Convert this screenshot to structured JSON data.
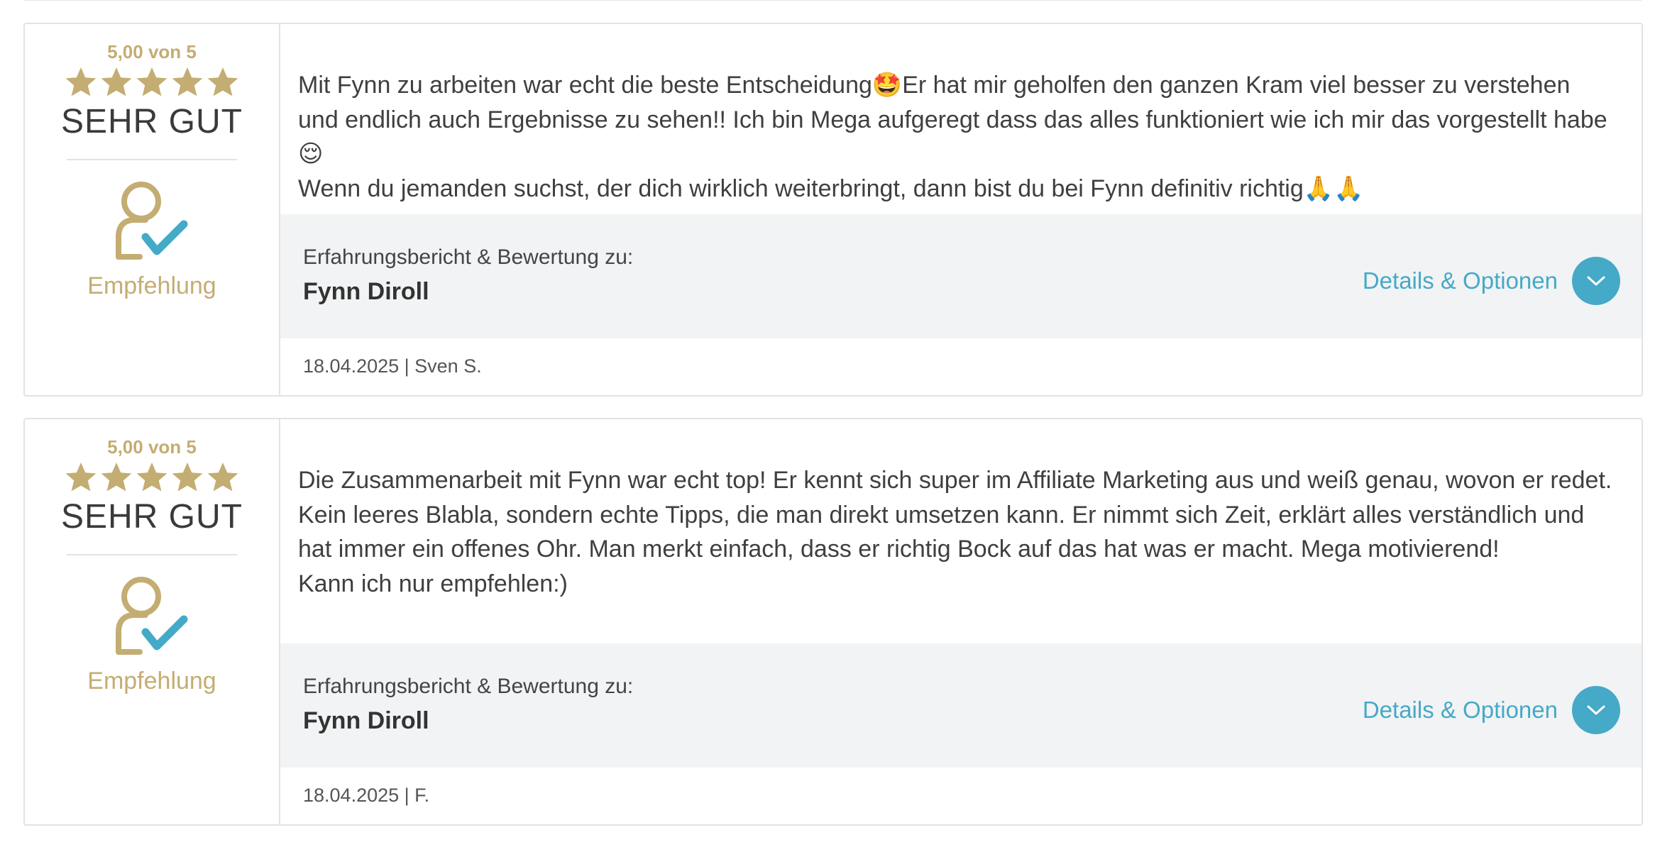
{
  "colors": {
    "gold": "#c4ad72",
    "accent": "#45a9c8",
    "about_bg": "#f2f3f4",
    "border": "#e3e3e3"
  },
  "reviews": [
    {
      "score": "5,00 von 5",
      "stars": 5,
      "rating_label": "SEHR GUT",
      "recommend_icon": "user-check-icon",
      "recommend_label": "Empfehlung",
      "text": "Mit Fynn zu arbeiten war echt die beste Entscheidung🤩Er hat mir geholfen den ganzen Kram viel besser zu verstehen und endlich auch Ergebnisse zu sehen!! Ich bin Mega aufgeregt dass das alles funktioniert wie ich mir das vorgestellt habe😌\nWenn du jemanden suchst, der dich wirklich weiterbringt, dann bist du bei Fynn definitiv richtig🙏🙏",
      "about_caption": "Erfahrungsbericht & Bewertung zu:",
      "about_name": "Fynn Diroll",
      "details_label": "Details & Optionen",
      "meta": "18.04.2025 | Sven S."
    },
    {
      "score": "5,00 von 5",
      "stars": 5,
      "rating_label": "SEHR GUT",
      "recommend_icon": "user-check-icon",
      "recommend_label": "Empfehlung",
      "text": "Die Zusammenarbeit mit Fynn war echt top! Er kennt sich super im Affiliate Marketing aus und weiß genau, wovon er redet. Kein leeres Blabla, sondern echte Tipps, die man direkt umsetzen kann. Er nimmt sich Zeit, erklärt alles verständlich und hat immer ein offenes Ohr. Man merkt einfach, dass er richtig Bock auf das hat was er macht. Mega motivierend!\nKann ich nur empfehlen:)",
      "about_caption": "Erfahrungsbericht & Bewertung zu:",
      "about_name": "Fynn Diroll",
      "details_label": "Details & Optionen",
      "meta": "18.04.2025 | F."
    }
  ]
}
